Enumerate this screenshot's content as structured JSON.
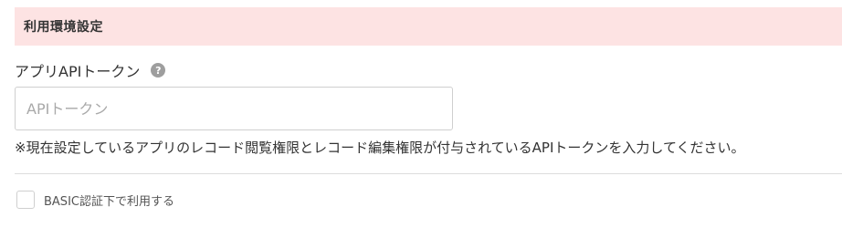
{
  "section": {
    "title": "利用環境設定"
  },
  "api_token": {
    "label": "アプリAPIトークン",
    "help_icon": "question-circle-icon",
    "help_glyph": "?",
    "placeholder": "APIトークン",
    "value": "",
    "note": "※現在設定しているアプリのレコード閲覧権限とレコード編集権限が付与されているAPIトークンを入力してください。"
  },
  "basic_auth": {
    "label": "BASIC認証下で利用する",
    "checked": false
  },
  "colors": {
    "header_bg": "#fde3e3",
    "text": "#333333",
    "placeholder": "#a9a9a9",
    "border": "#cfcfcf",
    "help_icon": "#9e9e9e"
  }
}
